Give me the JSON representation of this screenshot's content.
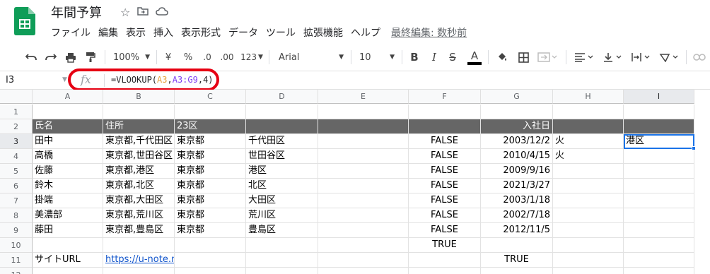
{
  "header": {
    "title": "年間予算",
    "star_icon": "star-icon",
    "move_icon": "folder-move-icon",
    "cloud_icon": "cloud-icon",
    "menu": [
      "ファイル",
      "編集",
      "表示",
      "挿入",
      "表示形式",
      "データ",
      "ツール",
      "拡張機能",
      "ヘルプ"
    ],
    "last_edit": "最終編集: 数秒前"
  },
  "toolbar": {
    "zoom": "100%",
    "currency": "¥",
    "percent": "%",
    "dec_decrease": ".0",
    "dec_increase": ".00",
    "format_more": "123",
    "font": "Arial",
    "font_size": "10",
    "bold": "B",
    "italic": "I",
    "strike": "S",
    "text_color": "A"
  },
  "formula_bar": {
    "name_box": "I3",
    "fx": "fx",
    "formula_prefix": "=VLOOKUP(",
    "ref1": "A3",
    "comma1": ",",
    "ref2": "A3:G9",
    "comma2": ",4)"
  },
  "columns": [
    "A",
    "B",
    "C",
    "D",
    "E",
    "F",
    "G",
    "H",
    "I"
  ],
  "rows": [
    "1",
    "2",
    "3",
    "4",
    "5",
    "6",
    "7",
    "8",
    "9",
    "10",
    "11",
    "12"
  ],
  "sheet": {
    "header_row": {
      "A": "氏名",
      "B": "住所",
      "C": "23区",
      "G": "入社日"
    },
    "data": [
      {
        "A": "田中",
        "B": "東京都,千代田区",
        "C": "東京都",
        "D": "千代田区",
        "F": "FALSE",
        "G": "2003/12/2",
        "H": "火",
        "I": "港区"
      },
      {
        "A": "高橋",
        "B": "東京都,世田谷区",
        "C": "東京都",
        "D": "世田谷区",
        "F": "FALSE",
        "G": "2010/4/15",
        "H": "火",
        "I": ""
      },
      {
        "A": "佐藤",
        "B": "東京都,港区",
        "C": "東京都",
        "D": "港区",
        "F": "FALSE",
        "G": "2009/9/16",
        "H": "",
        "I": ""
      },
      {
        "A": "鈴木",
        "B": "東京都,北区",
        "C": "東京都",
        "D": "北区",
        "F": "FALSE",
        "G": "2021/3/27",
        "H": "",
        "I": ""
      },
      {
        "A": "掛端",
        "B": "東京都,大田区",
        "C": "東京都",
        "D": "大田区",
        "F": "FALSE",
        "G": "2003/1/18",
        "H": "",
        "I": ""
      },
      {
        "A": "美濃部",
        "B": "東京都,荒川区",
        "C": "東京都",
        "D": "荒川区",
        "F": "FALSE",
        "G": "2002/7/18",
        "H": "",
        "I": ""
      },
      {
        "A": "藤田",
        "B": "東京都,豊島区",
        "C": "東京都",
        "D": "豊島区",
        "F": "FALSE",
        "G": "2012/11/5",
        "H": "",
        "I": ""
      }
    ],
    "row10": {
      "F": "TRUE"
    },
    "row11": {
      "A": "サイトURL",
      "B": "https://u-note.me/",
      "G": "TRUE"
    }
  },
  "colors": {
    "header_fill": "#666666",
    "selection": "#1a73e8",
    "annotation": "#e60012",
    "link": "#1155cc"
  }
}
